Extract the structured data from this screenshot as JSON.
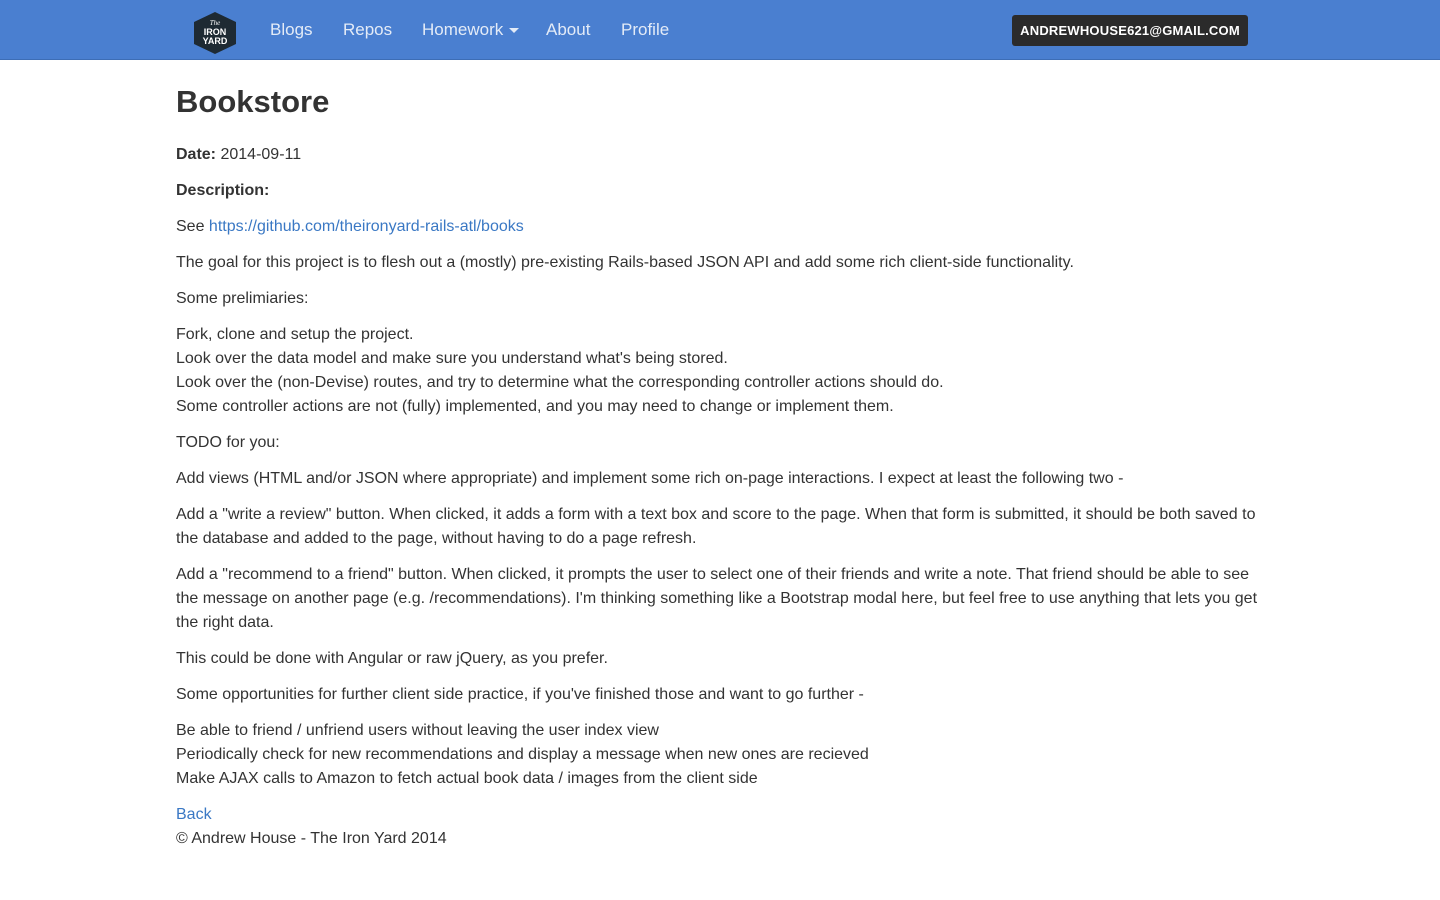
{
  "navbar": {
    "logo_alt": "The Iron Yard",
    "logo_lines": [
      "The",
      "IRON",
      "YARD"
    ],
    "links": [
      "Blogs",
      "Repos",
      "Homework",
      "About",
      "Profile"
    ],
    "user_button": "ANDREWHOUSE621@GMAIL.COM"
  },
  "page": {
    "title": "Bookstore",
    "date_label": "Date:",
    "date_value": "2014-09-11",
    "description_label": "Description:",
    "see_prefix": "See",
    "repo_link": "https://github.com/theironyard-rails-atl/books",
    "goal": "The goal for this project is to flesh out a (mostly) pre-existing Rails-based JSON API and add some rich client-side functionality.",
    "prelim_heading": "Some prelimiaries:",
    "prelim_items": [
      "Fork, clone and setup the project.",
      "Look over the data model and make sure you understand what's being stored.",
      "Look over the (non-Devise) routes, and try to determine what the corresponding controller actions should do.",
      "Some controller actions are not (fully) implemented, and you may need to change or implement them."
    ],
    "todo_heading": "TODO for you:",
    "todo_intro": "Add views (HTML and/or JSON where appropriate) and implement some rich on-page interactions. I expect at least the following two -",
    "todo_review": "Add a \"write a review\" button. When clicked, it adds a form with a text box and score to the page. When that form is submitted, it should be both saved to the database and added to the page, without having to do a page refresh.",
    "todo_recommend": "Add a \"recommend to a friend\" button. When clicked, it prompts the user to select one of their friends and write a note. That friend should be able to see the message on another page (e.g. /recommendations). I'm thinking something like a Bootstrap modal here, but feel free to use anything that lets you get the right data.",
    "todo_tools": "This could be done with Angular or raw jQuery, as you prefer.",
    "further_heading": "Some opportunities for further client side practice, if you've finished those and want to go further -",
    "further_items": [
      "Be able to friend / unfriend users without leaving the user index view",
      "Periodically check for new recommendations and display a message when new ones are recieved",
      "Make AJAX calls to Amazon to fetch actual book data / images from the client side"
    ],
    "back_link": "Back",
    "footer": "© Andrew House - The Iron Yard 2014"
  },
  "colors": {
    "navbar": "#4a7fd0",
    "link": "#3a78c4",
    "button": "#2b2b2b"
  }
}
